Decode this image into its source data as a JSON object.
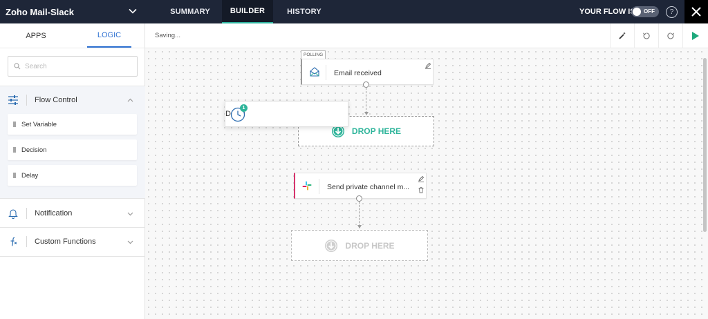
{
  "header": {
    "flow_name": "Zoho Mail-Slack",
    "tabs": [
      {
        "label": "SUMMARY",
        "active": false
      },
      {
        "label": "BUILDER",
        "active": true
      },
      {
        "label": "HISTORY",
        "active": false
      }
    ],
    "your_flow_label": "YOUR FLOW IS",
    "toggle_label": "OFF",
    "help_label": "?",
    "colors": {
      "bar": "#1e2638",
      "active_tab_underline": "#2fb5a0"
    }
  },
  "left_panel": {
    "tabs": [
      {
        "label": "APPS",
        "active": false
      },
      {
        "label": "LOGIC",
        "active": true
      }
    ],
    "search": {
      "placeholder": "Search",
      "value": ""
    },
    "sections": [
      {
        "label": "Flow Control",
        "icon": "sliders-icon",
        "expanded": true,
        "items": [
          "Set Variable",
          "Decision",
          "Delay"
        ]
      },
      {
        "label": "Notification",
        "icon": "bell-icon",
        "expanded": false
      },
      {
        "label": "Custom Functions",
        "icon": "function-icon",
        "expanded": false
      }
    ]
  },
  "toolbar": {
    "status": "Saving...",
    "buttons": [
      "magic-wand-icon",
      "undo-icon",
      "redo-icon",
      "play-icon"
    ],
    "play_color": "#1ea97c"
  },
  "canvas": {
    "trigger": {
      "badge": "POLLING",
      "label": "Email received",
      "icon": "envelope-icon"
    },
    "drop_zone_1": {
      "label": "DROP HERE",
      "color": "#2fb59b"
    },
    "dragging": {
      "label": "Delay",
      "icon": "clock-icon",
      "badge": "1"
    },
    "action": {
      "label": "Send private channel m...",
      "icon": "slack-icon",
      "accent": "#d6336c"
    },
    "drop_zone_2": {
      "label": "DROP HERE",
      "color": "#c8c8c8"
    }
  }
}
